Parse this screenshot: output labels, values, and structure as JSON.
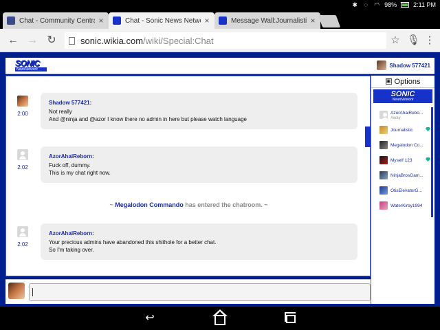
{
  "status": {
    "battery": "98%",
    "time": "2:11 PM"
  },
  "tabs": [
    {
      "title": "Chat - Community Central - V",
      "favicon_color": "#3a4a8a"
    },
    {
      "title": "Chat - Sonic News Network",
      "favicon_color": "#1632c8"
    },
    {
      "title": "Message Wall:Journalistic -",
      "favicon_color": "#1632c8"
    }
  ],
  "address": {
    "host": "sonic.wikia.com",
    "path": "/wiki/Special:Chat"
  },
  "header": {
    "logo_line1": "SONIC",
    "logo_line2": "NewsNetwork",
    "user": "Shadow 577421"
  },
  "messages": [
    {
      "name": "Shadow 577421:",
      "time": "2:00",
      "lines": [
        "Not really",
        "And @ninja and @azor I know there no admin in here but please watch language"
      ]
    },
    {
      "name": "AzorAhaiReborn:",
      "time": "2:02",
      "lines": [
        "Fuck off, dummy.",
        "This is my chat right now."
      ]
    },
    {
      "name": "AzorAhaiReborn:",
      "time": "2:02",
      "lines": [
        "Your precious admins have abandoned this shithole for a better chat.",
        "So I'm taking over."
      ]
    }
  ],
  "join": {
    "prefix": "~ ",
    "name": "Megalodon Commando",
    "suffix": " has entered the chatroom. ~"
  },
  "sidebar": {
    "options_label": "Options",
    "logo_line1": "SONIC",
    "logo_line2": "NewsNetwork",
    "users": [
      {
        "name": "AzorAhaiRebo...",
        "status": "Away"
      },
      {
        "name": "Journalistic"
      },
      {
        "name": "Megalodon Co..."
      },
      {
        "name": "Myself 123"
      },
      {
        "name": "NinjaBrosGam..."
      },
      {
        "name": "OtisElevatorG..."
      },
      {
        "name": "WaterKirby1994"
      }
    ]
  },
  "colors": {
    "brand_blue": "#1632c8",
    "page_bg": "#001f8f",
    "name_blue": "#1a2b9b",
    "mod_gem": "#1db39a"
  }
}
